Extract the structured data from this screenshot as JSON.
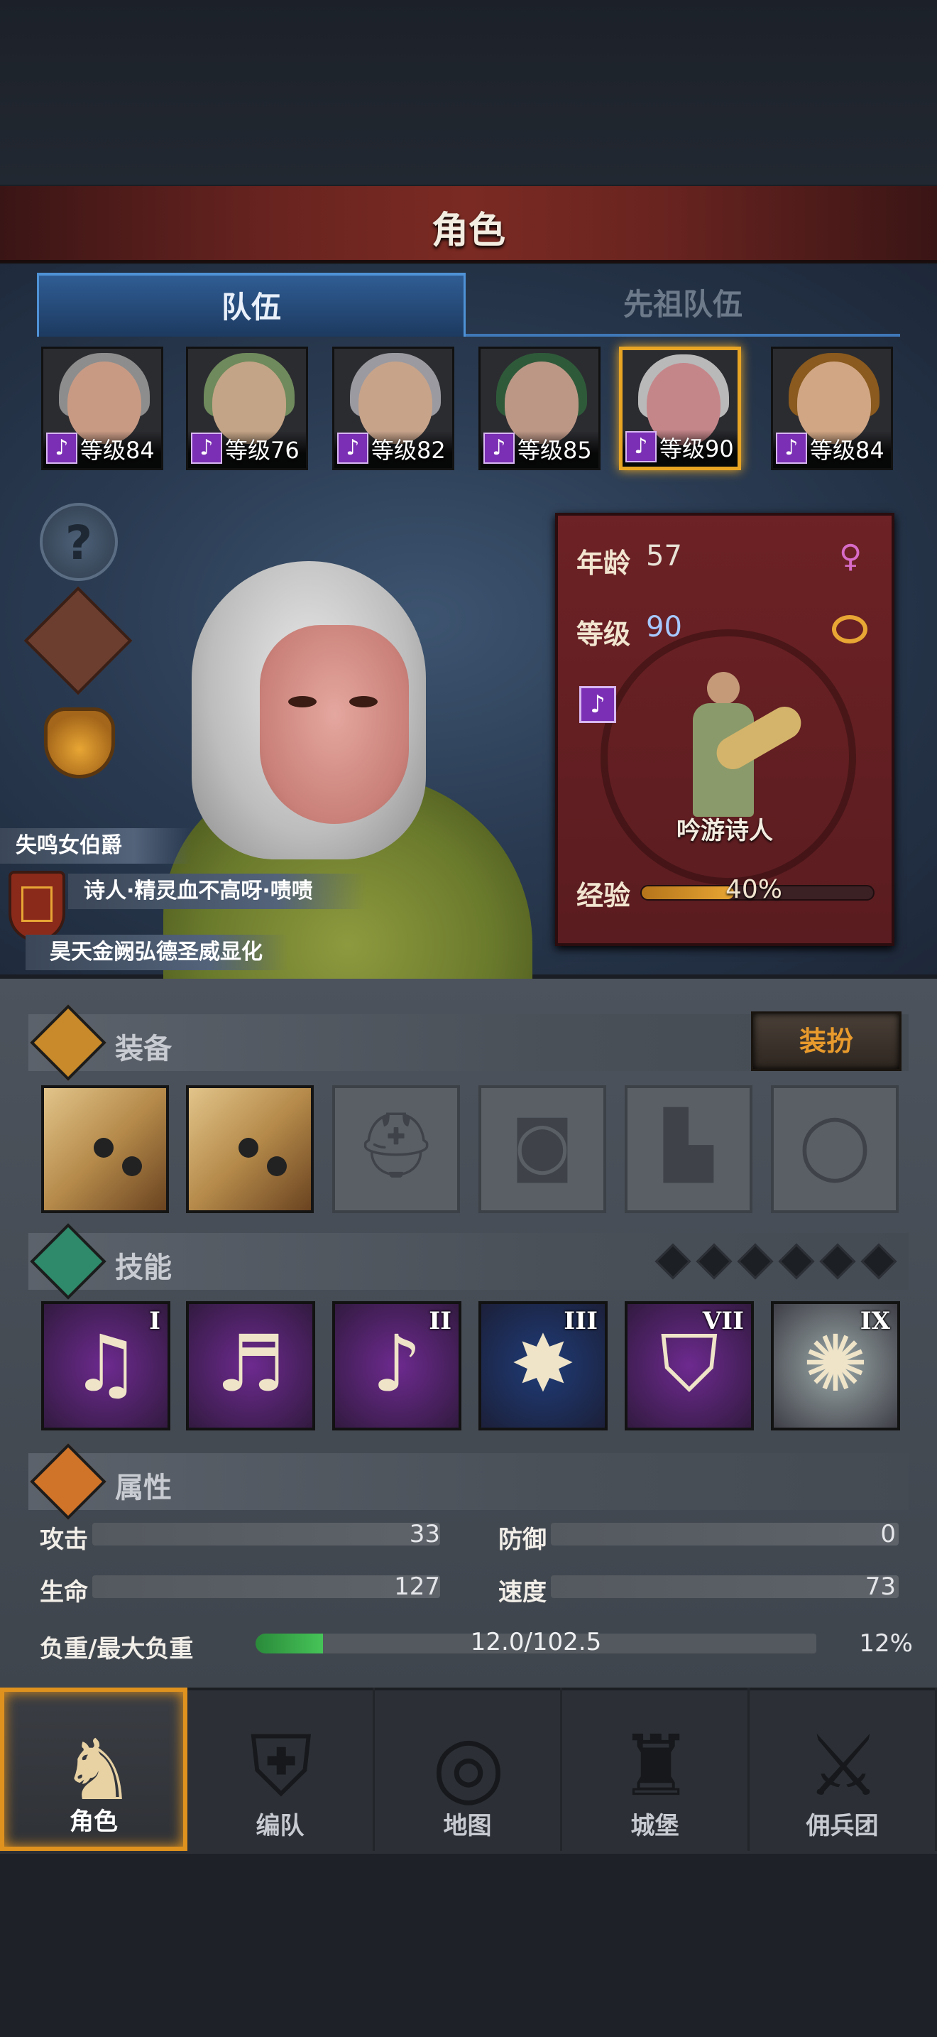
{
  "header": {
    "title": "角色"
  },
  "tabs": [
    {
      "label": "队伍"
    },
    {
      "label": "先祖队伍"
    }
  ],
  "party": [
    {
      "level_label": "等级84",
      "skin": "#c89a84",
      "hair": "#8d8d8d"
    },
    {
      "level_label": "等级76",
      "skin": "#c4a486",
      "hair": "#6f8a5c"
    },
    {
      "level_label": "等级82",
      "skin": "#c7a38a",
      "hair": "#9a9aa0"
    },
    {
      "level_label": "等级85",
      "skin": "#bd9786",
      "hair": "#2f5a3a"
    },
    {
      "level_label": "等级90",
      "skin": "#c5868a",
      "hair": "#b9b9b9"
    },
    {
      "level_label": "等级84",
      "skin": "#d1a684",
      "hair": "#8a5a1e"
    }
  ],
  "character": {
    "age_label": "年龄",
    "age": "57",
    "level_label": "等级",
    "level": "90",
    "class_name": "吟游诗人",
    "exp_label": "经验",
    "exp_percent": "40%",
    "exp_fraction": 0.4,
    "title1": "失鸣女伯爵",
    "title2": "诗人·精灵血不高呀·啧啧",
    "title3": "昊天金阙弘德圣威显化"
  },
  "equipment": {
    "title": "装备",
    "dress_button": "装扮"
  },
  "skills": {
    "title": "技能",
    "items": [
      {
        "numeral": "I",
        "color": "#6d2a8f"
      },
      {
        "numeral": "",
        "color": "#6d2a8f"
      },
      {
        "numeral": "II",
        "color": "#6d2a8f"
      },
      {
        "numeral": "III",
        "color": "#1f3c78"
      },
      {
        "numeral": "VII",
        "color": "#6d2a8f"
      },
      {
        "numeral": "IX",
        "color": "#9aa8a8"
      }
    ]
  },
  "attributes": {
    "title": "属性",
    "attack_label": "攻击",
    "attack": "33",
    "defense_label": "防御",
    "defense": "0",
    "hp_label": "生命",
    "hp": "127",
    "speed_label": "速度",
    "speed": "73",
    "load_label": "负重/最大负重",
    "load": "12.0/102.5",
    "load_percent": "12%"
  },
  "nav": [
    {
      "label": "角色",
      "icon": "knight-icon"
    },
    {
      "label": "编队",
      "icon": "helmet-icon"
    },
    {
      "label": "地图",
      "icon": "compass-map-icon"
    },
    {
      "label": "城堡",
      "icon": "castle-icon"
    },
    {
      "label": "佣兵团",
      "icon": "mercenary-icon"
    }
  ]
}
